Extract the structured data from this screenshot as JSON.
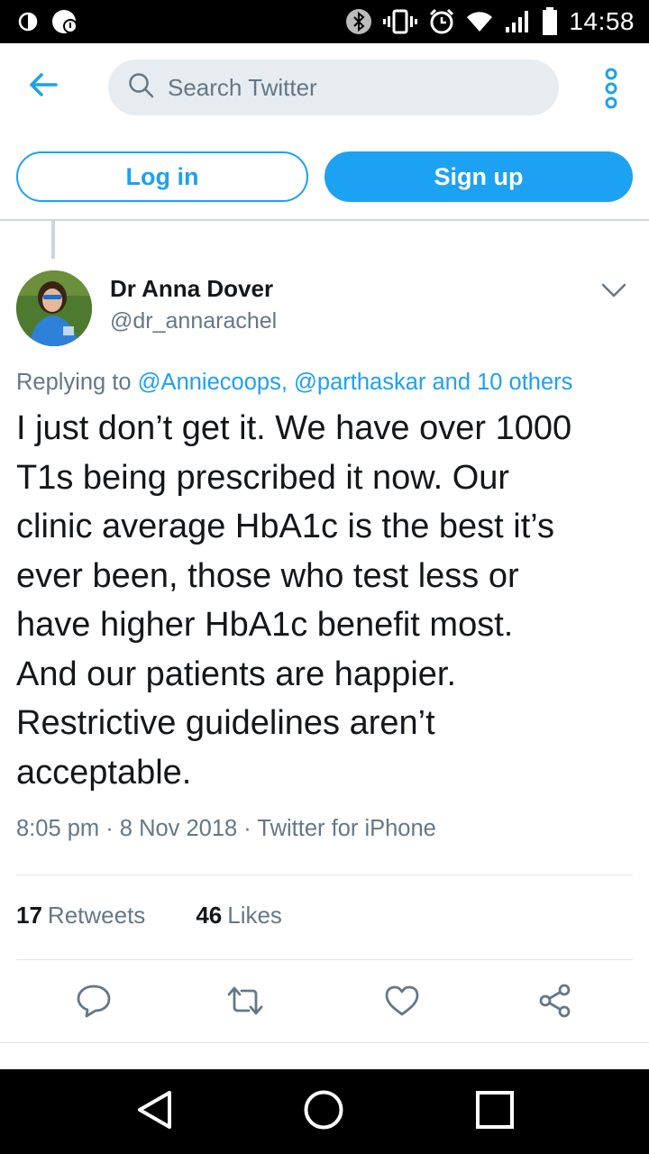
{
  "status_bar": {
    "time": "14:58",
    "icons": [
      "data-saver-icon",
      "notification-icon",
      "bluetooth-icon",
      "vibrate-icon",
      "alarm-icon",
      "wifi-icon",
      "signal-icon",
      "battery-icon"
    ]
  },
  "header": {
    "search_placeholder": "Search Twitter",
    "back_icon": "arrow-left-icon",
    "more_icon": "more-vertical-icon"
  },
  "auth": {
    "login_label": "Log in",
    "signup_label": "Sign up"
  },
  "tweet": {
    "author_name": "Dr Anna Dover",
    "author_handle": "@dr_annarachel",
    "replying_prefix": "Replying to ",
    "reply_mention_1": "@Anniecoops",
    "reply_separator": ", ",
    "reply_mention_2": "@parthaskar",
    "reply_joiner": " and ",
    "reply_others": "10 others",
    "text_lines": [
      "I just don’t get it. We have over 1000",
      "T1s being prescribed it now. Our",
      "clinic average HbA1c is the best it’s",
      "ever been, those who test less or",
      "have higher HbA1c benefit most.",
      "And our patients are happier.",
      "Restrictive guidelines aren’t",
      "acceptable."
    ],
    "meta": "8:05 pm · 8 Nov 2018 · Twitter for iPhone",
    "retweet_count": "17",
    "retweet_label": "Retweets",
    "like_count": "46",
    "like_label": "Likes"
  },
  "colors": {
    "accent": "#1da1f2",
    "secondary_text": "#657786",
    "primary_text": "#14171a",
    "search_bg": "#e6ecf0"
  }
}
